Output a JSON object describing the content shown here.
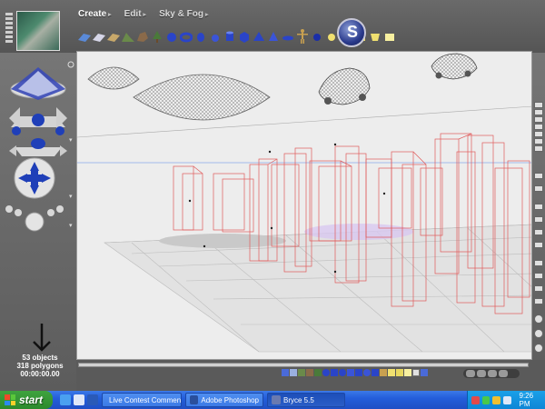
{
  "menus": [
    {
      "label": "Create",
      "active": true
    },
    {
      "label": "Edit",
      "active": false
    },
    {
      "label": "Sky & Fog",
      "active": false
    }
  ],
  "stats": {
    "objects": "53 objects",
    "polygons": "318 polygons",
    "time": "00:00:00.00"
  },
  "taskbar": {
    "start_label": "start",
    "tasks": [
      {
        "label": "Live Contest Commen...",
        "icon_color": "#3c7ad8",
        "active": false
      },
      {
        "label": "Adobe Photoshop",
        "icon_color": "#2a4f9c",
        "active": false
      },
      {
        "label": "Bryce 5.5",
        "icon_color": "#6a7ab0",
        "active": true
      }
    ],
    "clock": "9:26 PM"
  },
  "colors": {
    "wire_grey": "#777777",
    "wire_red": "#e05a5a",
    "accent_blue": "#1f3fb8",
    "xp_blue": "#245edb",
    "xp_green": "#3a9a3a"
  },
  "icons": {
    "logo": "bryce-logo-icon",
    "arrow": "arrow-down-icon"
  }
}
